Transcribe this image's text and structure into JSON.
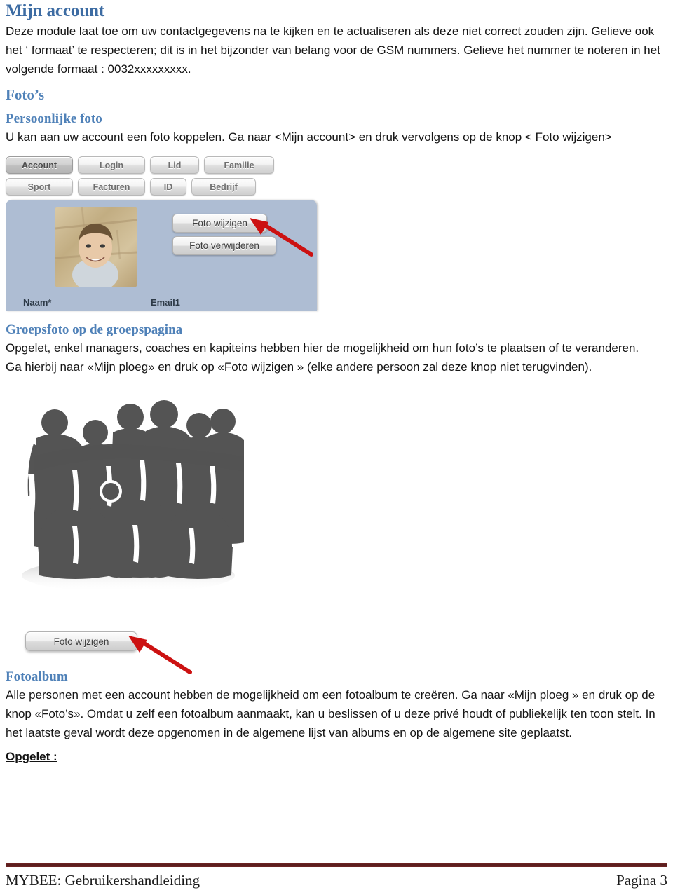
{
  "document": {
    "heading_main": "Mijn account",
    "intro_paragraph": "Deze module laat toe om uw contactgegevens na te kijken en te actualiseren als deze niet correct zouden zijn. Gelieve ook het ‘ formaat’ te respecteren; dit is in het bijzonder van belang voor de GSM nummers. Gelieve het nummer te noteren in het volgende formaat  : 0032xxxxxxxxx.",
    "section_photos_heading": "Foto’s",
    "subheading_personal_photo": "Persoonlijke foto",
    "personal_photo_paragraph": "U kan aan uw account een foto koppelen. Ga naar  <Mijn account> en druk vervolgens op de knop < Foto wijzigen>",
    "subheading_group_photo": "Groepsfoto op de groepspagina",
    "group_photo_paragraph_1": "Opgelet, enkel managers, coaches en kapiteins hebben hier de mogelijkheid om hun foto’s te plaatsen of te veranderen.",
    "group_photo_paragraph_2": "Ga hierbij naar «Mijn ploeg» en druk op «Foto wijzigen » (elke andere persoon zal deze knop niet terugvinden).",
    "subheading_photo_album": "Fotoalbum",
    "photo_album_paragraph": "Alle personen met een account  hebben de mogelijkheid om een fotoalbum te creëren. Ga naar «Mijn ploeg » en druk op de knop «Foto’s». Omdat u zelf een fotoalbum aanmaakt, kan u beslissen of u deze privé houdt of publiekelijk ten toon stelt. In het laatste geval wordt deze opgenomen in de algemene lijst van albums en op de algemene site geplaatst.",
    "notice_label": "Opgelet :"
  },
  "screenshot_account": {
    "tabs_row_1": [
      {
        "label": "Account",
        "active": true
      },
      {
        "label": "Login",
        "active": false
      },
      {
        "label": "Lid",
        "active": false
      },
      {
        "label": "Familie",
        "active": false
      }
    ],
    "tabs_row_2": [
      {
        "label": "Sport",
        "active": false
      },
      {
        "label": "Facturen",
        "active": false
      },
      {
        "label": "ID",
        "active": false
      },
      {
        "label": "Bedrijf",
        "active": false
      }
    ],
    "buttons": {
      "change_photo": "Foto wijzigen",
      "delete_photo": "Foto verwijderen"
    },
    "field_labels": {
      "name": "Naam*",
      "email": "Email1"
    },
    "panel_color": "#aebdd3",
    "annotation_arrow_color": "#cc1111"
  },
  "screenshot_group": {
    "button_change_photo": "Foto wijzigen",
    "silhouette_color": "#545454",
    "annotation_arrow_color": "#cc1111"
  },
  "footer": {
    "left_text": "MYBEE: Gebruikershandleiding",
    "right_text": "Pagina 3",
    "rule_color": "#5c1f1f"
  },
  "colors": {
    "heading_main": "#3d6ca3",
    "heading_section": "#4f81b8",
    "body_text": "#141414"
  }
}
